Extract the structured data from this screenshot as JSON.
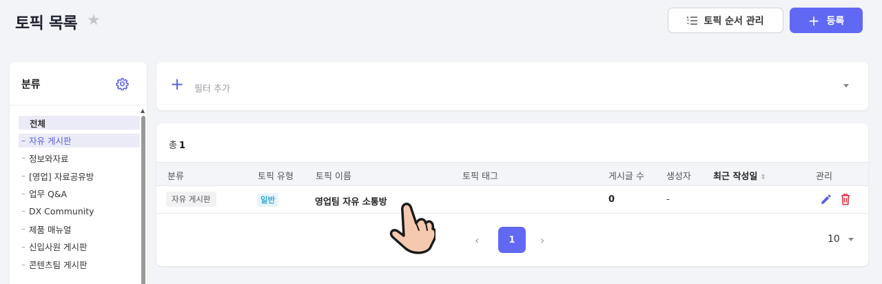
{
  "header": {
    "title": "토픽 목록",
    "order_button_label": "토픽 순서 관리",
    "add_button_label": "등록",
    "accent_color": "#6168f4"
  },
  "sidebar": {
    "title": "분류",
    "items": [
      {
        "label": "전체",
        "state": "selected"
      },
      {
        "label": "자유 게시판",
        "state": "active"
      },
      {
        "label": "정보와자료"
      },
      {
        "label": "[영업] 자료공유방"
      },
      {
        "label": "업무 Q&A"
      },
      {
        "label": "DX Community"
      },
      {
        "label": "제품 매뉴얼"
      },
      {
        "label": "신입사원 게시판"
      },
      {
        "label": "콘텐츠팀 게시판"
      }
    ]
  },
  "filter": {
    "add_label": "필터 추가"
  },
  "table": {
    "total_label": "총",
    "total_count": "1",
    "columns": [
      "분류",
      "토픽 유형",
      "토픽 이름",
      "토픽 태그",
      "게시글 수",
      "생성자",
      "최근 작성일",
      "관리"
    ],
    "rows": [
      {
        "category": "자유 게시판",
        "type": "일반",
        "name": "영업팀 자유 소통방",
        "tags": "",
        "post_count": "0",
        "creator": "-",
        "last_posted": ""
      }
    ]
  },
  "pagination": {
    "current_page": "1",
    "page_size": "10"
  }
}
